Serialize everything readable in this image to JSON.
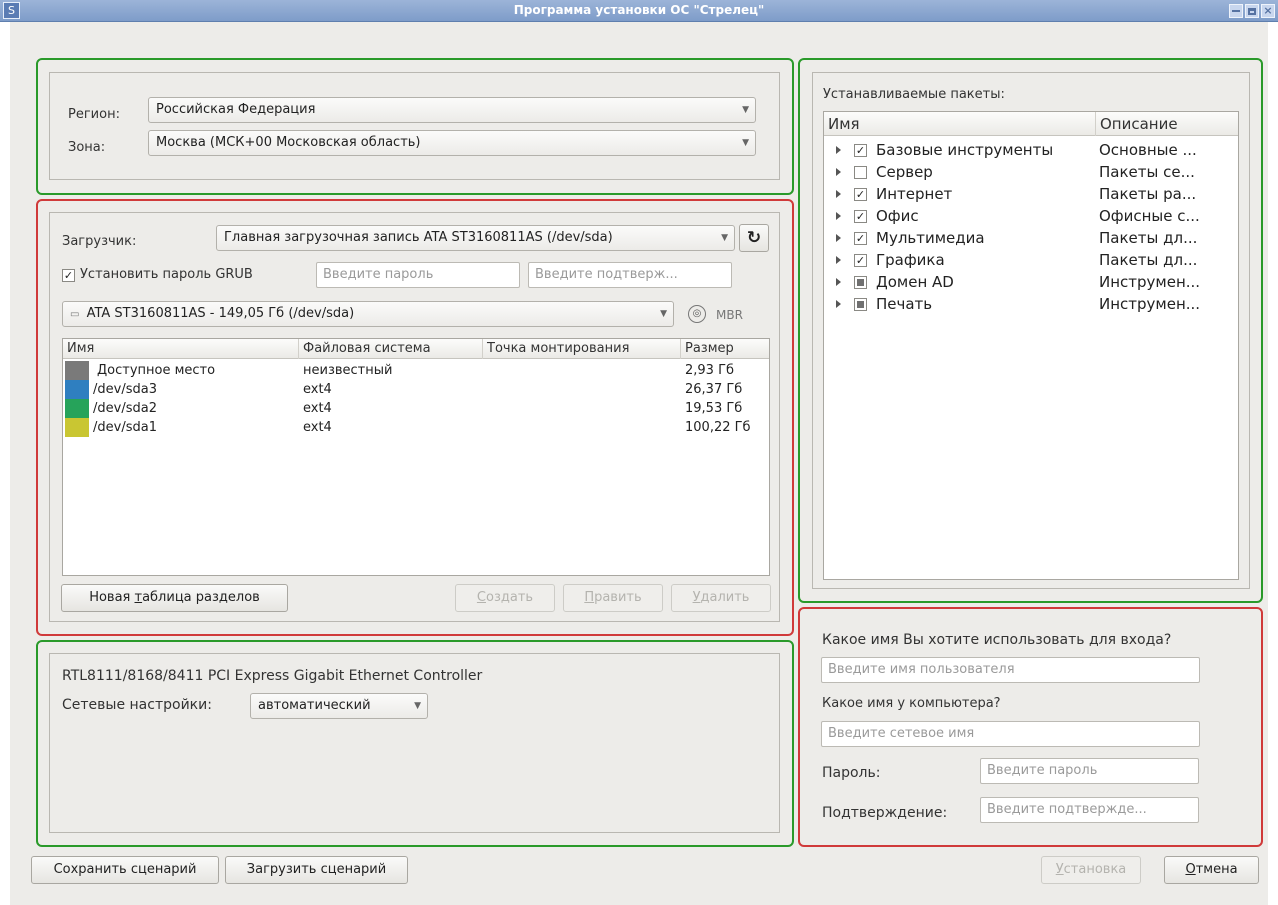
{
  "window": {
    "title": "Программа установки ОС \"Стрелец\"",
    "app_icon_glyph": "S"
  },
  "region": {
    "region_label": "Регион:",
    "region_value": "Российская Федерация",
    "zone_label": "Зона:",
    "zone_value": "Москва (МСК+00 Московская область)"
  },
  "bootloader": {
    "label": "Загрузчик:",
    "value": "Главная загрузочная запись ATA ST3160811AS (/dev/sda)",
    "set_grub_label": "Установить пароль GRUB",
    "set_grub_checked": "✓",
    "password_placeholder": "Введите пароль",
    "confirm_placeholder": "Введите подтверж...",
    "disk_value": "ATA ST3160811AS - 149,05 Гб (/dev/sda)",
    "table_type": "MBR"
  },
  "partitions": {
    "columns": [
      "Имя",
      "Файловая система",
      "Точка монтирования",
      "Размер"
    ],
    "rows": [
      {
        "name": "Доступное место",
        "fs": "неизвестный",
        "mount": "",
        "size": "2,93 Гб",
        "color": "#7a7a7a"
      },
      {
        "name": "/dev/sda3",
        "fs": "ext4",
        "mount": "",
        "size": "26,37 Гб",
        "color": "#2f7fc0"
      },
      {
        "name": "/dev/sda2",
        "fs": "ext4",
        "mount": "",
        "size": "19,53 Гб",
        "color": "#26a35a"
      },
      {
        "name": "/dev/sda1",
        "fs": "ext4",
        "mount": "",
        "size": "100,22 Гб",
        "color": "#c9c632"
      }
    ],
    "new_table_prefix": "Новая ",
    "new_table_mnemonic": "т",
    "new_table_suffix": "аблица разделов",
    "create_mnemonic": "С",
    "create_rest": "оздать",
    "edit_mnemonic": "П",
    "edit_rest": "равить",
    "delete_mnemonic": "У",
    "delete_rest": "далить"
  },
  "network": {
    "adapter": "RTL8111/8168/8411 PCI Express Gigabit Ethernet Controller",
    "settings_label": "Сетевые настройки:",
    "settings_value": "автоматический"
  },
  "packages": {
    "title": "Устанавливаемые пакеты:",
    "columns": [
      "Имя",
      "Описание"
    ],
    "items": [
      {
        "name": "Базовые инструменты",
        "desc": "Основные ...",
        "state": "checked"
      },
      {
        "name": "Сервер",
        "desc": "Пакеты се...",
        "state": "unchecked"
      },
      {
        "name": "Интернет",
        "desc": "Пакеты ра...",
        "state": "checked"
      },
      {
        "name": "Офис",
        "desc": "Офисные с...",
        "state": "checked"
      },
      {
        "name": "Мультимедиа",
        "desc": "Пакеты дл...",
        "state": "checked"
      },
      {
        "name": "Графика",
        "desc": "Пакеты дл...",
        "state": "checked"
      },
      {
        "name": "Домен AD",
        "desc": "Инструмен...",
        "state": "partial"
      },
      {
        "name": "Печать",
        "desc": "Инструмен...",
        "state": "partial"
      }
    ]
  },
  "user": {
    "login_question": "Какое имя Вы хотите использовать для входа?",
    "username_placeholder": "Введите имя пользователя",
    "hostname_question": "Какое имя у компьютера?",
    "hostname_placeholder": "Введите сетевое имя",
    "password_label": "Пароль:",
    "password_placeholder": "Введите пароль",
    "confirm_label": "Подтверждение:",
    "confirm_placeholder": "Введите подтвержде..."
  },
  "footer": {
    "save_label": "Сохранить сценарий",
    "load_label": "Загрузить сценарий",
    "install_mnemonic": "У",
    "install_rest": "становка",
    "cancel_mnemonic": "О",
    "cancel_rest": "тмена"
  },
  "colors": {
    "green_frame": "#2a9a2a",
    "red_frame": "#d03a3a"
  },
  "icons": {
    "refresh": "refresh-icon",
    "disk": "disk-icon",
    "mbr": "mbr-icon"
  }
}
